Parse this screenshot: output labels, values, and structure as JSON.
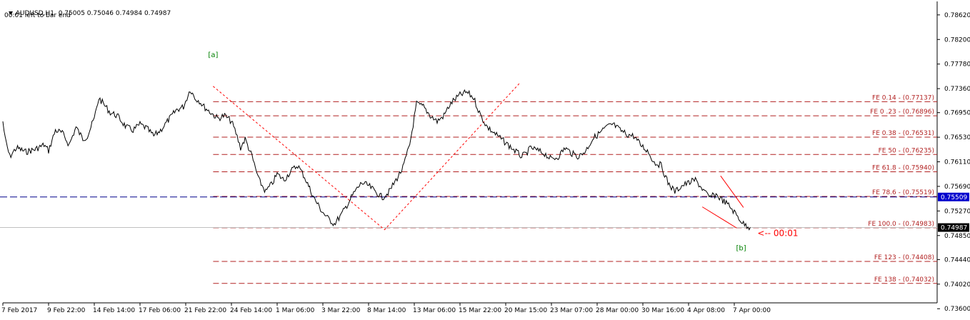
{
  "header": {
    "symbol_line": "AUDUSD,H1  0.75005 0.75046 0.74984 0.74987",
    "timer_line": "00:01 left to bar end"
  },
  "colors": {
    "background": "#ffffff",
    "price_line": "#000000",
    "fib_lines": "#b22222",
    "bid_line": "#00008b",
    "wave_labels": "#008000",
    "zigzag": "#ff0000",
    "current_price_badge": "#000000",
    "bid_badge": "#0000cd"
  },
  "chart_data": {
    "type": "line",
    "symbol": "AUDUSD",
    "timeframe": "H1",
    "ohlc_last": {
      "open": 0.75005,
      "high": 0.75046,
      "low": 0.74984,
      "close": 0.74987
    },
    "ylim": [
      0.737,
      0.7885
    ],
    "yticks": [
      0.7862,
      0.782,
      0.7778,
      0.7736,
      0.7695,
      0.7653,
      0.7611,
      0.7569,
      0.7527,
      0.7485,
      0.7444,
      0.7402,
      0.736
    ],
    "yticks_labels": [
      "0.78620",
      "0.78200",
      "0.77780",
      "0.77360",
      "0.76950",
      "0.76530",
      "0.76110",
      "0.75690",
      "0.75270",
      "0.74850",
      "0.74440",
      "0.74020",
      "0.73600"
    ],
    "xticks_labels": [
      "7 Feb 2017",
      "9 Feb 22:00",
      "14 Feb 14:00",
      "17 Feb 06:00",
      "21 Feb 22:00",
      "24 Feb 14:00",
      "1 Mar 06:00",
      "3 Mar 22:00",
      "8 Mar 14:00",
      "13 Mar 06:00",
      "15 Mar 22:00",
      "20 Mar 15:00",
      "23 Mar 07:00",
      "28 Mar 00:00",
      "30 Mar 16:00",
      "4 Apr 08:00",
      "7 Apr 00:00"
    ],
    "xticks_index": [
      0,
      1,
      2,
      3,
      4,
      5,
      6,
      7,
      8,
      9,
      10,
      11,
      12,
      13,
      14,
      15,
      16
    ],
    "series": [
      {
        "x": [
          0,
          0.05,
          0.15,
          0.3,
          0.5,
          0.7,
          0.9,
          1.0,
          1.15,
          1.3,
          1.45,
          1.6,
          1.75,
          1.85,
          2.0,
          2.1,
          2.2,
          2.35,
          2.5,
          2.7,
          2.85,
          3.0,
          3.15,
          3.3,
          3.45,
          3.6,
          3.8,
          3.95,
          4.1,
          4.2,
          4.3,
          4.4,
          4.55,
          4.7,
          4.85,
          5.0,
          5.1,
          5.2,
          5.3,
          5.45,
          5.6,
          5.75,
          5.9,
          6.0,
          6.15,
          6.3,
          6.45,
          6.6,
          6.8,
          6.95,
          7.1,
          7.25,
          7.4,
          7.55,
          7.7,
          7.85,
          8.0,
          8.15,
          8.3,
          8.45,
          8.6,
          8.75,
          8.9,
          9.05,
          9.2,
          9.35,
          9.5,
          9.65,
          9.75,
          9.85,
          10.0,
          10.15,
          10.3,
          10.45,
          10.6,
          10.75,
          10.9,
          11.05,
          11.2,
          11.35,
          11.45,
          11.55,
          11.7,
          11.85,
          12.0,
          12.15,
          12.3,
          12.45,
          12.6,
          12.75,
          12.9,
          13.05,
          13.2,
          13.35,
          13.5,
          13.65,
          13.8,
          13.95,
          14.1,
          14.25,
          14.4,
          14.55,
          14.7,
          14.85,
          15.0,
          15.15,
          15.3,
          15.45,
          15.6,
          15.75,
          15.9,
          16.05,
          16.2,
          16.35
        ],
        "values": [
          0.768,
          0.765,
          0.762,
          0.7635,
          0.7628,
          0.7632,
          0.764,
          0.763,
          0.7665,
          0.766,
          0.764,
          0.767,
          0.765,
          0.7655,
          0.7685,
          0.772,
          0.771,
          0.7695,
          0.769,
          0.767,
          0.7665,
          0.7675,
          0.7668,
          0.7655,
          0.7665,
          0.768,
          0.77,
          0.7705,
          0.7735,
          0.772,
          0.7715,
          0.7705,
          0.7695,
          0.7685,
          0.769,
          0.768,
          0.766,
          0.7635,
          0.765,
          0.762,
          0.758,
          0.756,
          0.7575,
          0.759,
          0.758,
          0.7595,
          0.7605,
          0.7585,
          0.755,
          0.753,
          0.7515,
          0.7505,
          0.752,
          0.754,
          0.756,
          0.7575,
          0.757,
          0.756,
          0.755,
          0.756,
          0.758,
          0.76,
          0.764,
          0.771,
          0.7705,
          0.769,
          0.768,
          0.769,
          0.7705,
          0.7715,
          0.7725,
          0.773,
          0.772,
          0.769,
          0.767,
          0.766,
          0.765,
          0.764,
          0.763,
          0.762,
          0.7625,
          0.7635,
          0.763,
          0.7625,
          0.7615,
          0.762,
          0.7635,
          0.7625,
          0.762,
          0.763,
          0.765,
          0.766,
          0.767,
          0.7675,
          0.7665,
          0.7658,
          0.7655,
          0.764,
          0.763,
          0.761,
          0.7605,
          0.7575,
          0.756,
          0.757,
          0.7575,
          0.758,
          0.7565,
          0.755,
          0.7555,
          0.7545,
          0.7535,
          0.752,
          0.7505,
          0.7499
        ]
      }
    ],
    "fib_levels": [
      {
        "label": "FE 0.14 - (0.77137)",
        "value": 0.77137
      },
      {
        "label": "FE 0 .23 - (0.76896)",
        "value": 0.76896
      },
      {
        "label": "FE 0.38 - (0.76531)",
        "value": 0.76531
      },
      {
        "label": "FE 50 - (0.76235)",
        "value": 0.76235
      },
      {
        "label": "FE 61.8 - (0.75940)",
        "value": 0.7594
      },
      {
        "label": "FE 78.6 - (0.75519)",
        "value": 0.75519
      },
      {
        "label": "FE 100.0 - (0.74983)",
        "value": 0.74983
      },
      {
        "label": "FE 123 - (0.74408)",
        "value": 0.74408
      },
      {
        "label": "FE 138 - (0.74032)",
        "value": 0.74032
      }
    ],
    "fib_start_index": 4.6,
    "bid_line": {
      "value": 0.75509,
      "label": "0.75509"
    },
    "current_price": {
      "value": 0.74987,
      "label": "0.74987"
    },
    "wave_labels": [
      {
        "text": "[a]",
        "x": 4.6,
        "y": 0.779
      },
      {
        "text": "[b]",
        "x": 16.15,
        "y": 0.746
      }
    ],
    "zigzag": [
      {
        "x": 4.6,
        "y": 0.774
      },
      {
        "x": 8.35,
        "y": 0.7495
      },
      {
        "x": 11.3,
        "y": 0.7745
      }
    ],
    "channel_lines": [
      [
        {
          "x": 15.7,
          "y": 0.7587
        },
        {
          "x": 16.2,
          "y": 0.7533
        }
      ],
      [
        {
          "x": 15.3,
          "y": 0.7534
        },
        {
          "x": 16.05,
          "y": 0.7498
        }
      ]
    ],
    "countdown_label": "<-- 00:01",
    "grid": false,
    "legend": "none"
  }
}
